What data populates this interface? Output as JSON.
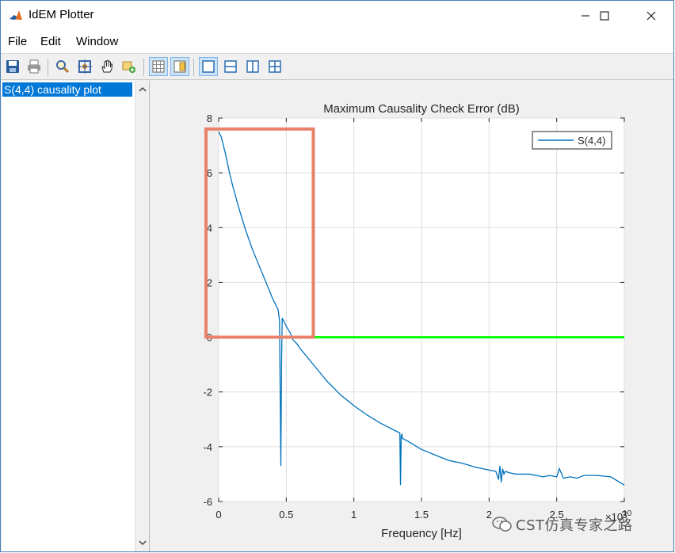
{
  "window": {
    "title": "IdEM Plotter",
    "controls": {
      "minimize_icon": "minimize-icon",
      "maximize_icon": "maximize-icon",
      "close_icon": "close-icon"
    }
  },
  "menu": [
    {
      "label": "File"
    },
    {
      "label": "Edit"
    },
    {
      "label": "Window"
    }
  ],
  "toolbar": {
    "buttons": [
      {
        "icon": "save-icon"
      },
      {
        "icon": "print-icon"
      },
      {
        "icon": "zoom-icon"
      },
      {
        "icon": "data-cursor-icon"
      },
      {
        "icon": "pan-hand-icon"
      },
      {
        "icon": "add-icon"
      },
      {
        "icon": "grid-toggle-icon",
        "toggled": true
      },
      {
        "icon": "legend-toggle-icon",
        "toggled": true
      },
      {
        "icon": "layout-single-icon",
        "toggled": true
      },
      {
        "icon": "layout-horizontal-split-icon"
      },
      {
        "icon": "layout-vertical-split-icon"
      },
      {
        "icon": "layout-quad-icon"
      }
    ]
  },
  "sidebar": {
    "items": [
      {
        "label": "S(4,4) causality plot",
        "selected": true
      }
    ]
  },
  "chart_data": {
    "type": "line",
    "title": "Maximum Causality Check Error (dB)",
    "xlabel": "Frequency [Hz]",
    "ylabel": "",
    "x_exponent_label": "×10",
    "x_exponent_power": "10",
    "xlim": [
      0,
      3
    ],
    "ylim": [
      -6,
      8
    ],
    "xticks": [
      "0",
      "0.5",
      "1",
      "1.5",
      "2",
      "2.5",
      "3"
    ],
    "yticks": [
      "8",
      "6",
      "4",
      "2",
      "0",
      "-2",
      "-4",
      "-6"
    ],
    "grid": true,
    "legend_position": "top-right",
    "series": [
      {
        "name": "S(4,4)",
        "color": "#0072bd",
        "x": [
          0,
          0.02,
          0.05,
          0.08,
          0.1,
          0.15,
          0.2,
          0.25,
          0.3,
          0.35,
          0.4,
          0.44,
          0.45,
          0.455,
          0.46,
          0.465,
          0.47,
          0.48,
          0.5,
          0.53,
          0.55,
          0.58,
          0.6,
          0.65,
          0.7,
          0.8,
          0.9,
          1.0,
          1.1,
          1.2,
          1.3,
          1.34,
          1.345,
          1.35,
          1.355,
          1.36,
          1.4,
          1.5,
          1.6,
          1.7,
          1.8,
          1.9,
          2.0,
          2.05,
          2.07,
          2.08,
          2.09,
          2.1,
          2.11,
          2.12,
          2.15,
          2.2,
          2.3,
          2.4,
          2.45,
          2.5,
          2.52,
          2.55,
          2.6,
          2.65,
          2.7,
          2.8,
          2.9,
          3.0
        ],
        "y": [
          7.5,
          7.3,
          6.7,
          6.0,
          5.6,
          4.7,
          3.9,
          3.2,
          2.6,
          2.0,
          1.4,
          1.0,
          0.6,
          -2.0,
          -4.7,
          -1.0,
          0.7,
          0.6,
          0.4,
          0.15,
          -0.1,
          -0.25,
          -0.4,
          -0.7,
          -1.0,
          -1.6,
          -2.1,
          -2.5,
          -2.85,
          -3.15,
          -3.4,
          -3.5,
          -5.4,
          -3.6,
          -3.55,
          -3.7,
          -3.8,
          -4.1,
          -4.3,
          -4.5,
          -4.6,
          -4.75,
          -4.85,
          -4.9,
          -5.2,
          -4.7,
          -5.3,
          -4.8,
          -5.0,
          -4.9,
          -4.95,
          -5.0,
          -5.0,
          -5.1,
          -5.05,
          -5.1,
          -4.8,
          -5.15,
          -5.1,
          -5.15,
          -5.05,
          -5.05,
          -5.1,
          -5.4
        ]
      },
      {
        "name": "",
        "color": "#00ff00",
        "x": [
          0,
          3
        ],
        "y": [
          0,
          0
        ]
      }
    ],
    "annotations": [
      {
        "type": "rectangle",
        "color": "#e8836a",
        "x_range": [
          0,
          0.7
        ],
        "y_range": [
          0,
          7.6
        ]
      }
    ]
  },
  "watermark": {
    "text": "CST仿真专家之路"
  }
}
